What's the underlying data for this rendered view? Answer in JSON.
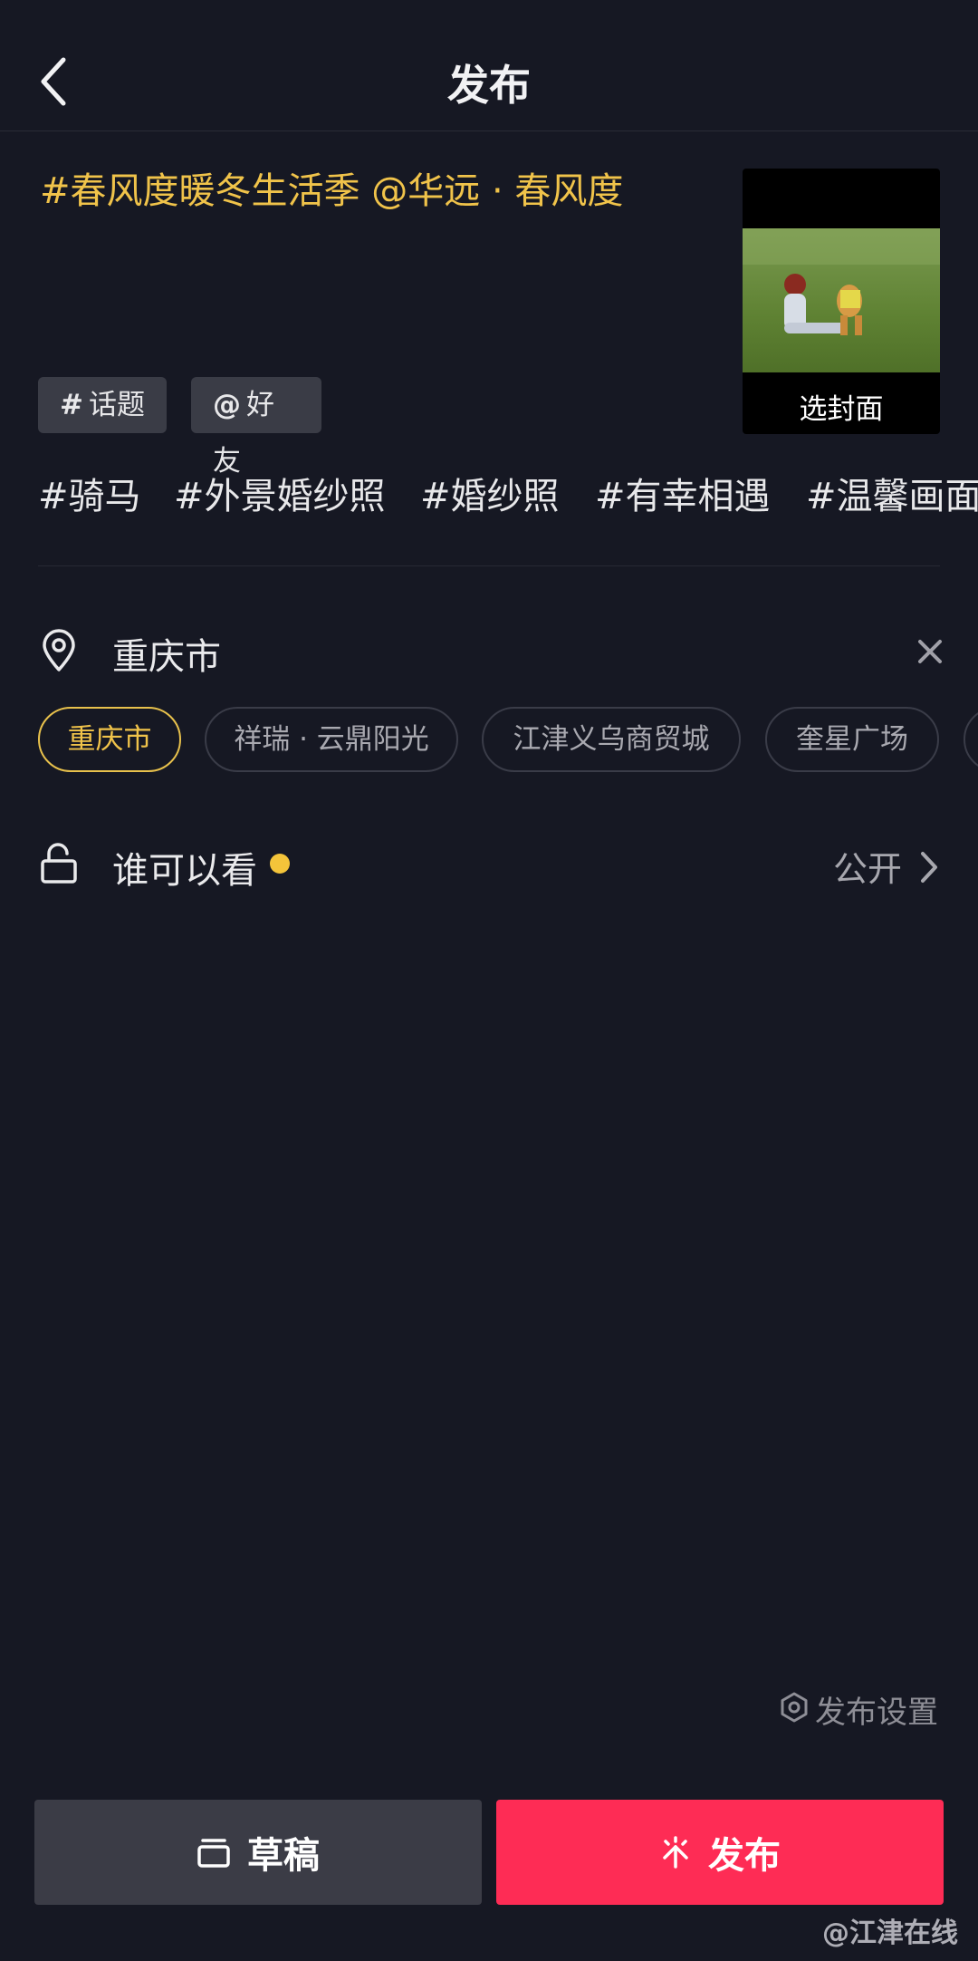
{
  "header": {
    "title": "发布"
  },
  "caption": {
    "text": "#春风度暖冬生活季 @华远 · 春风度"
  },
  "cover": {
    "label": "选封面"
  },
  "chips": {
    "topic": "话题",
    "friend": "好友"
  },
  "suggested_tags": [
    "#骑马",
    "#外景婚纱照",
    "#婚纱照",
    "#有幸相遇",
    "#温馨画面"
  ],
  "location": {
    "selected": "重庆市",
    "options": [
      "重庆市",
      "祥瑞 · 云鼎阳光",
      "江津义乌商贸城",
      "奎星广场"
    ]
  },
  "visibility": {
    "label": "谁可以看",
    "value": "公开"
  },
  "publish_settings": {
    "label": "发布设置"
  },
  "buttons": {
    "draft": "草稿",
    "publish": "发布"
  },
  "watermark": "@江津在线",
  "colors": {
    "background": "#161823",
    "accent": "#f0c34a",
    "publish": "#fe2c55",
    "draft": "#3b3c46"
  }
}
